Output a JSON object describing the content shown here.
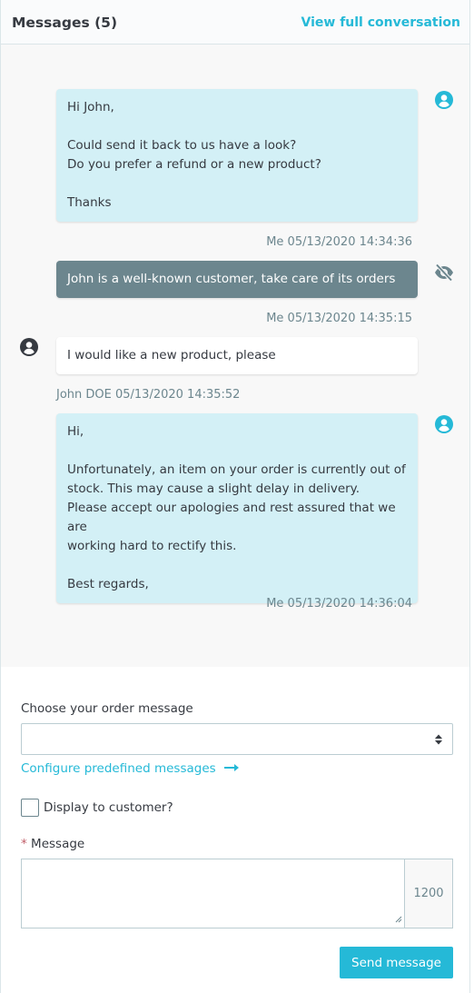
{
  "header": {
    "title": "Messages (5)",
    "link": "View full conversation"
  },
  "messages": [
    {
      "type": "employee",
      "lines": [
        "Hi John,",
        "",
        "Could send it back to us have a look?",
        "Do you prefer a refund or a new product?",
        "",
        "Thanks"
      ],
      "meta": "Me 05/13/2020 14:34:36",
      "icon": "user-circle-icon"
    },
    {
      "type": "private",
      "lines": [
        "John is a well-known customer, take care of its orders"
      ],
      "meta": "Me 05/13/2020 14:35:15",
      "icon": "eye-slash-icon"
    },
    {
      "type": "customer",
      "lines": [
        "I would like a new product, please"
      ],
      "meta": "John DOE 05/13/2020 14:35:52",
      "icon": "user-circle-icon"
    },
    {
      "type": "employee",
      "lines": [
        "Hi,",
        "",
        "Unfortunately, an item on your order is currently out of",
        "stock. This may cause a slight delay in delivery.",
        "Please accept our apologies and rest assured that we are",
        "working hard to rectify this.",
        "",
        "Best regards,"
      ],
      "meta": "Me 05/13/2020 14:36:04",
      "icon": "user-circle-icon"
    }
  ],
  "form": {
    "order_message_label": "Choose your order message",
    "order_message_value": "",
    "configure_link": "Configure predefined messages",
    "display_to_customer_label": "Display to customer?",
    "message_required_mark": "*",
    "message_label": "Message",
    "message_value": "",
    "char_counter": "1200",
    "send_button": "Send message"
  },
  "colors": {
    "accent": "#25b9d7",
    "employee_bubble": "#d3f0f6",
    "private_bubble": "#6c868e",
    "required": "#c05c67"
  }
}
